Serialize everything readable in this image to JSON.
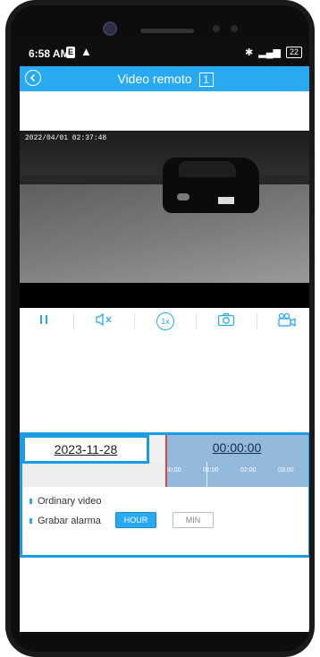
{
  "status": {
    "time": "6:58 AM",
    "e_badge": "E",
    "warning_glyph": "▲",
    "battery": "22"
  },
  "appbar": {
    "title": "Video remoto",
    "channel": "1"
  },
  "video": {
    "timestamp": "2022/04/01 02:37:48"
  },
  "controls": {
    "speed_label": "1x"
  },
  "timeline": {
    "date": "2023-11-28",
    "time": "00:00:00",
    "ticks": [
      "00:00",
      "01:00",
      "02:00",
      "03:00"
    ]
  },
  "legend": {
    "ordinary_video": "Ordinary video",
    "alarm_record": "Grabar alarma"
  },
  "scale_buttons": {
    "hour": "HOUR",
    "min": "MIN"
  },
  "colors": {
    "accent": "#29a9f2",
    "highlight_border": "#1a9be6",
    "timeline_fill": "#93b9dd",
    "cursor_line": "#e3443c"
  }
}
